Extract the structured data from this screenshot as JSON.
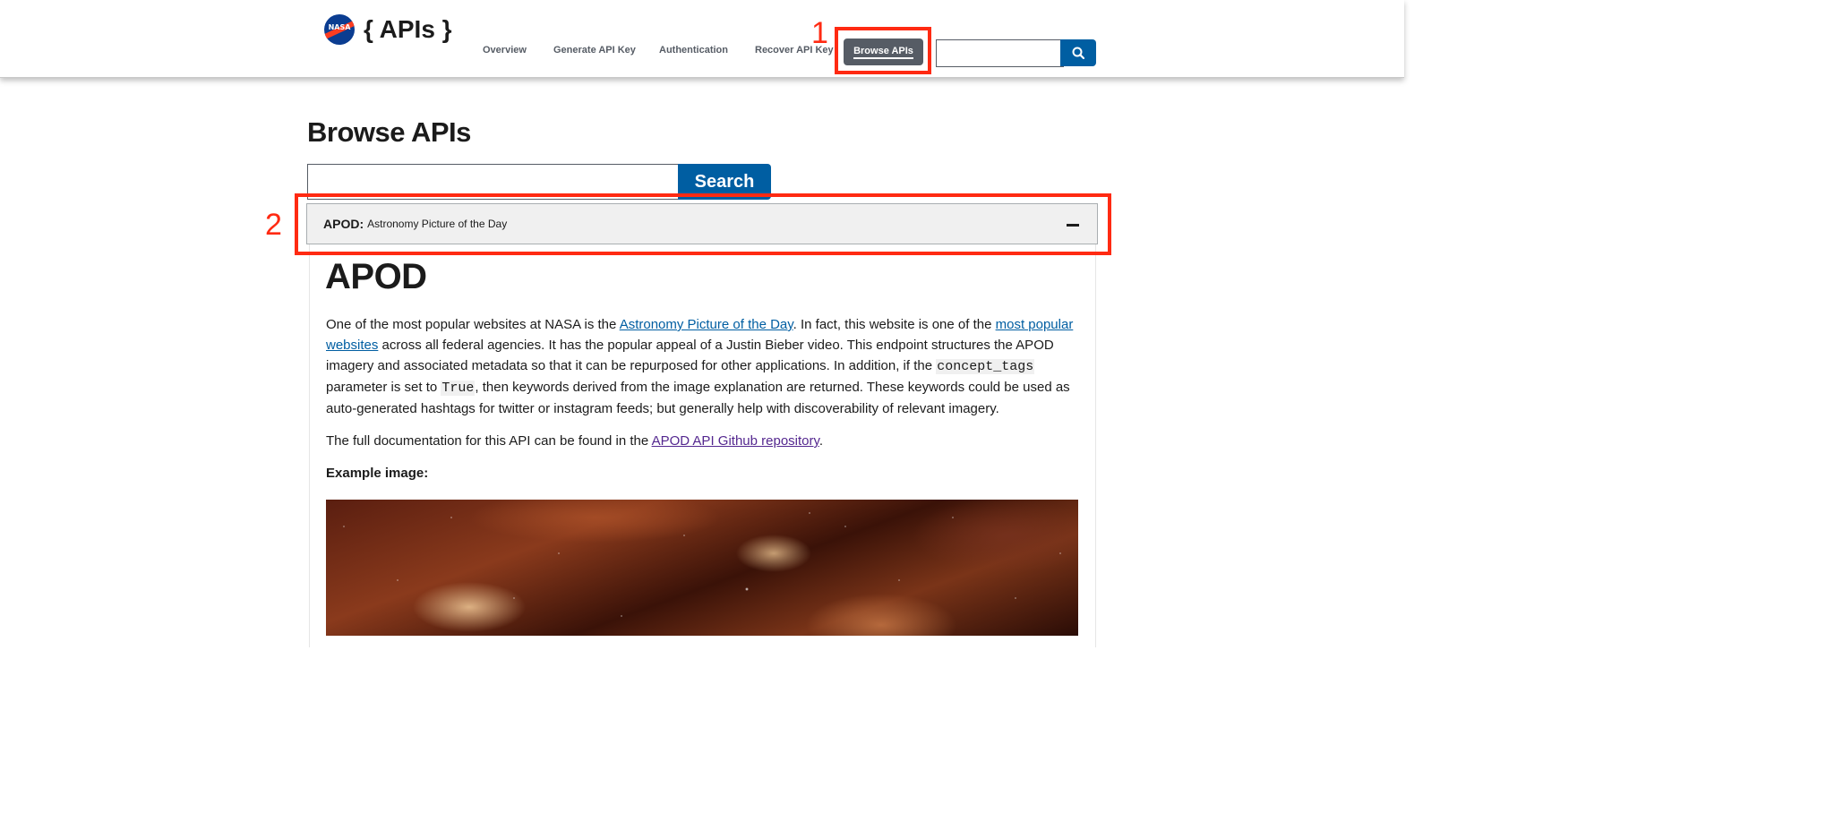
{
  "header": {
    "logo_icon": "nasa-meatball-icon",
    "logo_text": "NASA",
    "site_title": "{ APIs }",
    "nav": [
      {
        "label": "Overview"
      },
      {
        "label": "Generate API Key"
      },
      {
        "label": "Authentication"
      },
      {
        "label": "Recover API Key"
      },
      {
        "label": "Browse APIs"
      }
    ],
    "search_placeholder": "",
    "search_icon": "search-icon"
  },
  "annotations": [
    {
      "label": "1"
    },
    {
      "label": "2"
    }
  ],
  "main": {
    "title": "Browse APIs",
    "search_placeholder": "",
    "search_button": "Search",
    "accordion": {
      "code": "APOD:",
      "description": "Astronomy Picture of the Day",
      "toggle_icon": "minus-icon",
      "heading": "APOD",
      "para1": {
        "t1": "One of the most popular websites at NASA is the ",
        "link1": "Astronomy Picture of the Day",
        "t2": ". In fact, this website is one of the ",
        "link2": "most popular websites",
        "t3": " across all federal agencies. It has the popular appeal of a Justin Bieber video. This endpoint structures the APOD imagery and associated metadata so that it can be repurposed for other applications. In addition, if the ",
        "code1": "concept_tags",
        "t4": " parameter is set to ",
        "code2": "True",
        "t5": ", then keywords derived from the image explanation are returned. These keywords could be used as auto-generated hashtags for twitter or instagram feeds; but generally help with discoverability of relevant imagery."
      },
      "para2": {
        "t1": "The full documentation for this API can be found in the ",
        "link": "APOD API Github repository",
        "t2": "."
      },
      "example_label": "Example image:"
    }
  },
  "colors": {
    "primary": "#005ea2",
    "nav_active_bg": "#565c65",
    "annotation": "#ff2a12",
    "visited_link": "#54278f"
  }
}
